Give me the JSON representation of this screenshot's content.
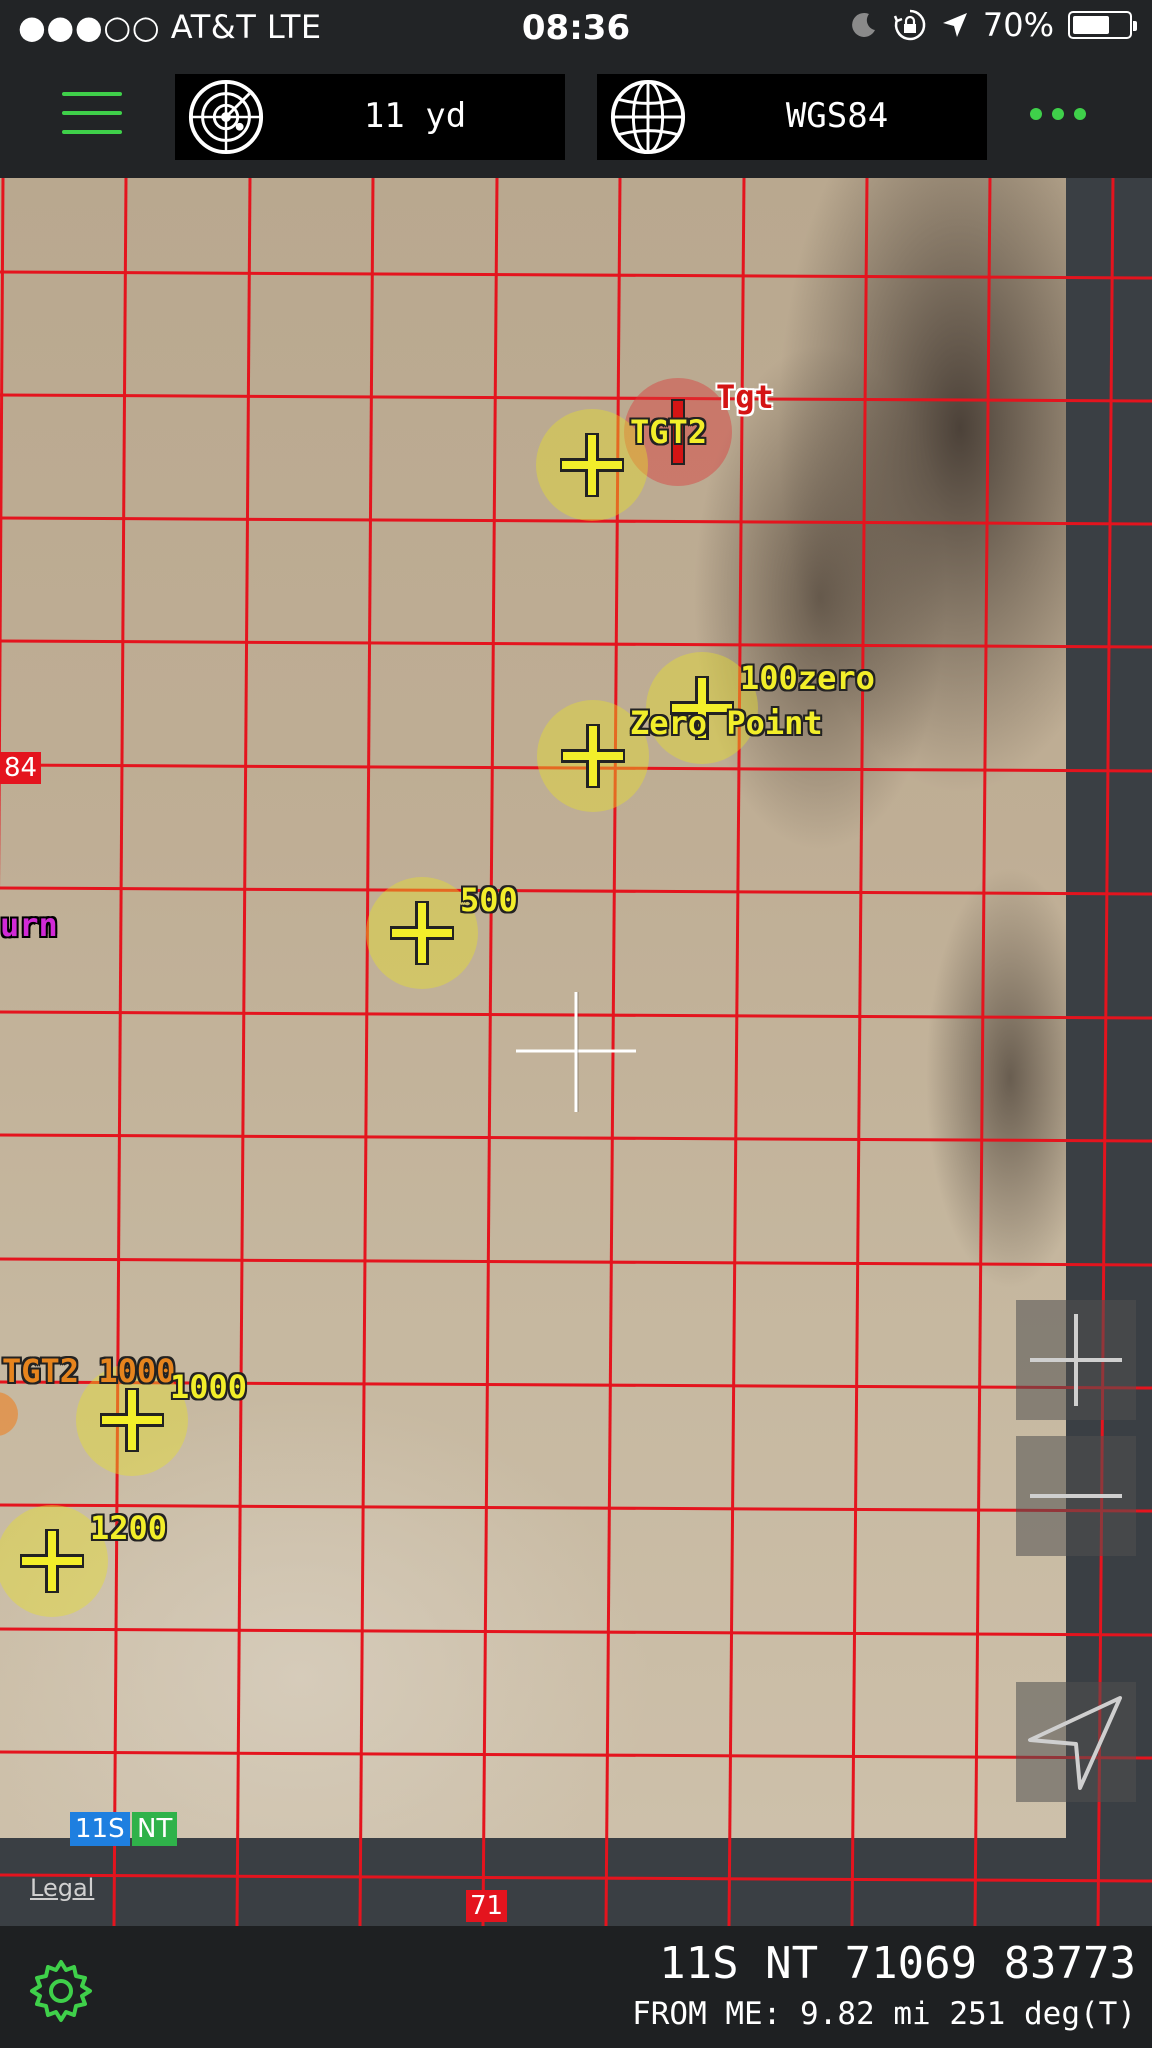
{
  "status_bar": {
    "carrier": "●●●○○ AT&T  LTE",
    "time": "08:36",
    "battery": "70%",
    "battery_level": 0.7,
    "icons": [
      "moon-icon",
      "rotation-lock-icon",
      "location-arrow-icon",
      "battery-icon"
    ]
  },
  "toolbar": {
    "range_value": "11 yd",
    "datum_value": "WGS84",
    "icons": [
      "menu-icon",
      "radar-icon",
      "globe-icon",
      "more-icon"
    ],
    "accent_color": "#3fd04a"
  },
  "map": {
    "markers": [
      {
        "label": "TGT2",
        "color": "yellow"
      },
      {
        "label": "Tgt",
        "color": "red"
      },
      {
        "label": "100zero",
        "color": "yellow"
      },
      {
        "label": "Zero Point",
        "color": "yellow"
      },
      {
        "label": "500",
        "color": "yellow"
      },
      {
        "label": "1000",
        "color": "yellow"
      },
      {
        "label": "1200",
        "color": "yellow"
      }
    ],
    "partial_labels": {
      "turn": "urn",
      "tgt2_1000": "TGT2 1000"
    },
    "grid_labels": {
      "left": "84",
      "bottom": "71"
    },
    "zone": {
      "gzd": "11S",
      "square": "NT"
    },
    "legal_link": "Legal",
    "grid_color": "#e4141e",
    "controls": [
      "zoom-in-icon",
      "zoom-out-icon",
      "navigation-arrow-icon"
    ]
  },
  "bottom_bar": {
    "coordinate": "11S NT 71069 83773",
    "from_me": "FROM ME: 9.82 mi 251 deg(T)",
    "icons": [
      "gear-icon"
    ]
  }
}
